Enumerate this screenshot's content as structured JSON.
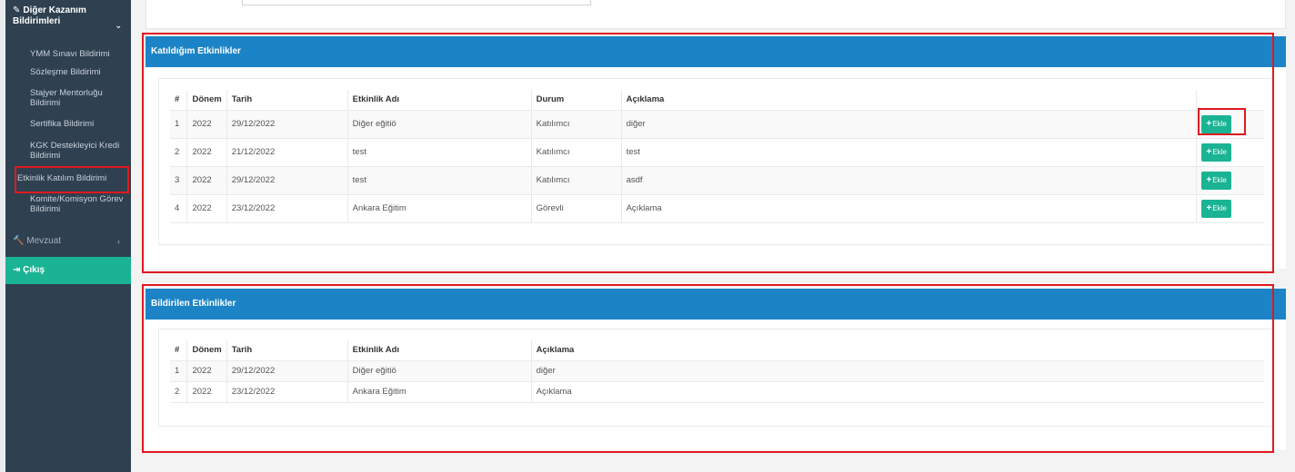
{
  "sidebar": {
    "section_title": "Diğer Kazanım Bildirimleri",
    "items": [
      {
        "label": "YMM Sınavı Bildirimi"
      },
      {
        "label": "Sözleşme Bildirimi"
      },
      {
        "label": "Stajyer Mentorluğu Bildirimi"
      },
      {
        "label": "Sertifika Bildirimi"
      },
      {
        "label": "KGK Destekleyici Kredi Bildirimi"
      },
      {
        "label": "Etkinlik Katılım Bildirimi"
      },
      {
        "label": "Komite/Komisyon Görev Bildirimi"
      }
    ],
    "mevzuat": "Mevzuat",
    "cikis": "Çıkış"
  },
  "panel1": {
    "title": "Katıldığım Etkinlikler",
    "headers": {
      "num": "#",
      "donem": "Dönem",
      "tarih": "Tarih",
      "ad": "Etkinlik Adı",
      "durum": "Durum",
      "aciklama": "Açıklama"
    },
    "rows": [
      {
        "num": "1",
        "donem": "2022",
        "tarih": "29/12/2022",
        "ad": "Diğer eğitiö",
        "durum": "Katılımcı",
        "aciklama": "diğer"
      },
      {
        "num": "2",
        "donem": "2022",
        "tarih": "21/12/2022",
        "ad": "test",
        "durum": "Katılımcı",
        "aciklama": "test"
      },
      {
        "num": "3",
        "donem": "2022",
        "tarih": "29/12/2022",
        "ad": "test",
        "durum": "Katılımcı",
        "aciklama": "asdf"
      },
      {
        "num": "4",
        "donem": "2022",
        "tarih": "23/12/2022",
        "ad": "Ankara Eğitim",
        "durum": "Görevli",
        "aciklama": "Açıklama"
      }
    ],
    "button_label": "Ekle"
  },
  "panel2": {
    "title": "Bildirilen Etkinlikler",
    "headers": {
      "num": "#",
      "donem": "Dönem",
      "tarih": "Tarih",
      "ad": "Etkinlik Adı",
      "aciklama": "Açıklama"
    },
    "rows": [
      {
        "num": "1",
        "donem": "2022",
        "tarih": "29/12/2022",
        "ad": "Diğer eğitiö",
        "aciklama": "diğer"
      },
      {
        "num": "2",
        "donem": "2022",
        "tarih": "23/12/2022",
        "ad": "Ankara Eğitim",
        "aciklama": "Açıklama"
      }
    ]
  },
  "colors": {
    "sidebar_bg": "#2f4050",
    "accent_green": "#1ab394",
    "panel_head_blue": "#1c84c6",
    "highlight_red": "#e0191f"
  },
  "icons": {
    "section": "edit-icon",
    "mevzuat": "gavel-icon",
    "cikis": "sign-out-icon",
    "plus": "plus-icon",
    "chevron": "chevron-down-icon"
  }
}
